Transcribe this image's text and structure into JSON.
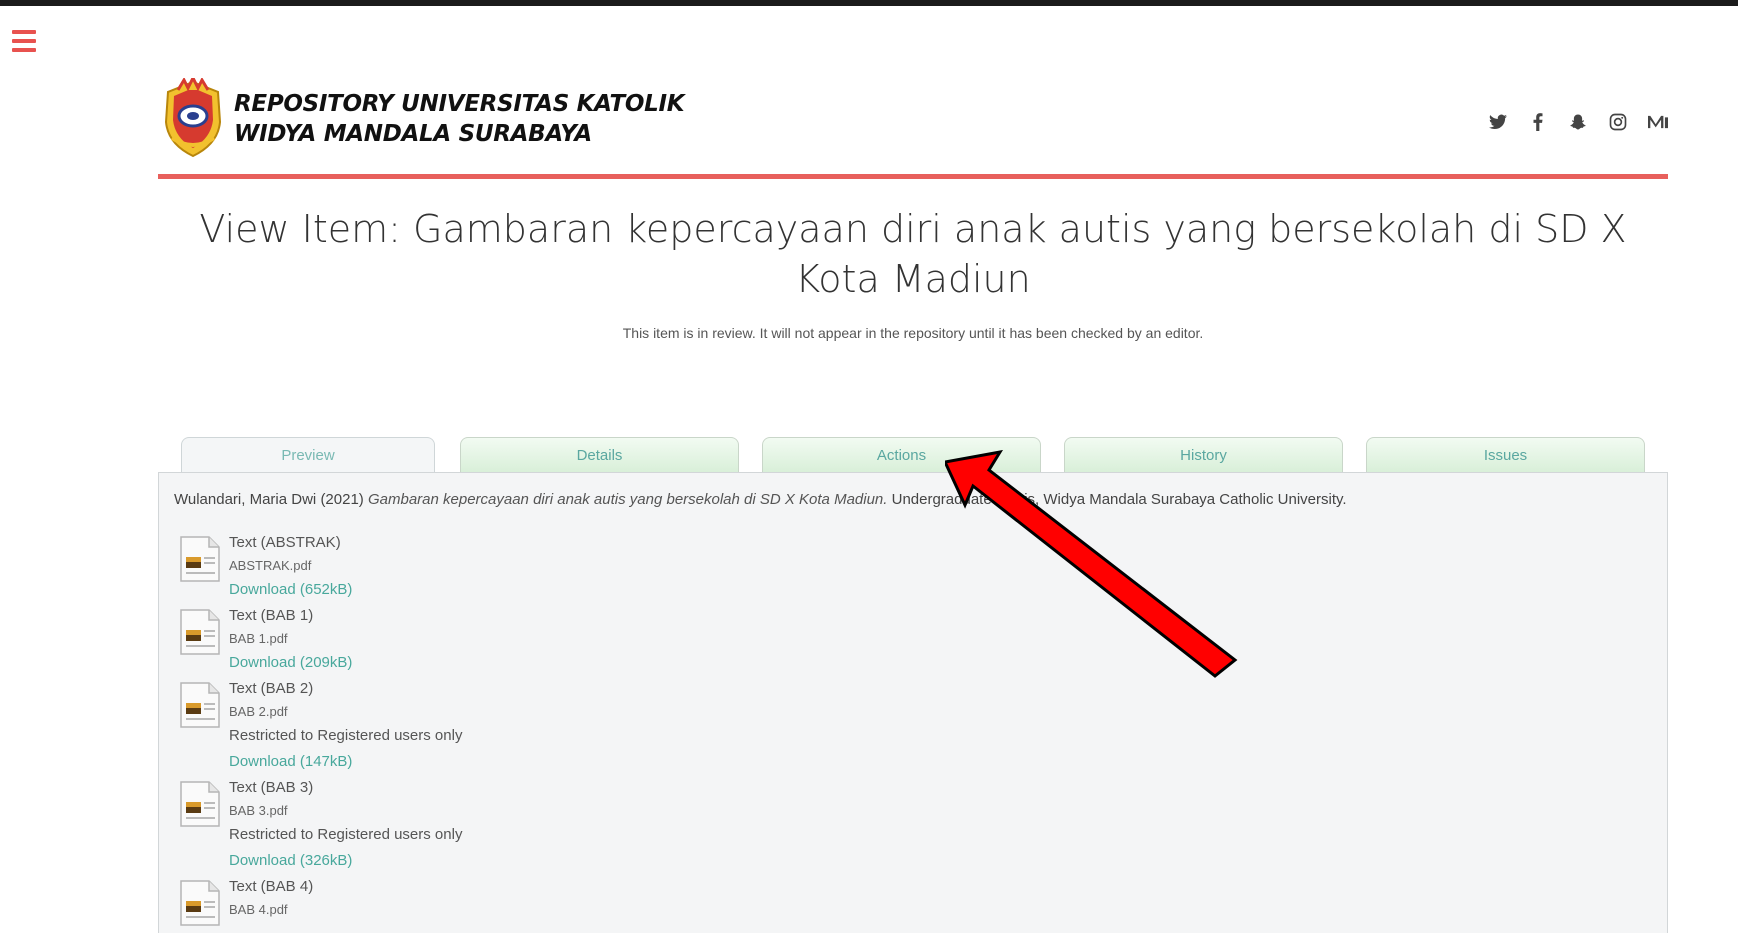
{
  "header": {
    "title_line1": "REPOSITORY UNIVERSITAS KATOLIK",
    "title_line2": "WIDYA MANDALA SURABAYA",
    "social": [
      "twitter-icon",
      "facebook-icon",
      "snapchat-icon",
      "instagram-icon",
      "medium-icon"
    ]
  },
  "page": {
    "title": "View Item: Gambaran kepercayaan diri anak autis yang bersekolah di SD X Kota Madiun",
    "review_note": "This item is in review. It will not appear in the repository until it has been checked by an editor."
  },
  "tabs": [
    {
      "label": "Preview",
      "active": true
    },
    {
      "label": "Details",
      "active": false
    },
    {
      "label": "Actions",
      "active": false
    },
    {
      "label": "History",
      "active": false
    },
    {
      "label": "Issues",
      "active": false
    }
  ],
  "citation": {
    "authors": "Wulandari, Maria Dwi",
    "year": "(2021)",
    "title": "Gambaran kepercayaan diri anak autis yang bersekolah di SD X Kota Madiun.",
    "suffix": "Undergraduate thesis, Widya Mandala Surabaya Catholic University."
  },
  "documents": [
    {
      "type": "Text (ABSTRAK)",
      "file": "ABSTRAK.pdf",
      "restricted": "",
      "download": "Download (652kB)"
    },
    {
      "type": "Text (BAB 1)",
      "file": "BAB 1.pdf",
      "restricted": "",
      "download": "Download (209kB)"
    },
    {
      "type": "Text (BAB 2)",
      "file": "BAB 2.pdf",
      "restricted": "Restricted to Registered users only",
      "download": "Download (147kB)"
    },
    {
      "type": "Text (BAB 3)",
      "file": "BAB 3.pdf",
      "restricted": "Restricted to Registered users only",
      "download": "Download (326kB)"
    },
    {
      "type": "Text (BAB 4)",
      "file": "BAB 4.pdf",
      "restricted": "",
      "download": ""
    }
  ],
  "colors": {
    "accent": "#e8605c",
    "link": "#48a89c",
    "tab_text": "#5aa7a0",
    "annotation_arrow": "#ff0000"
  }
}
